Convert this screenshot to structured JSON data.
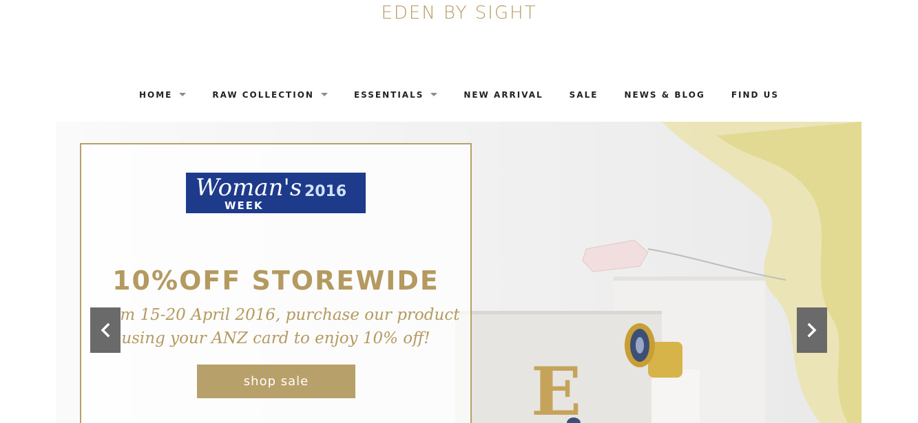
{
  "header": {
    "logo_text": "EDEN BY SIGHT"
  },
  "nav": {
    "items": [
      {
        "label": "HOME",
        "has_dropdown": true
      },
      {
        "label": "RAW COLLECTION",
        "has_dropdown": true
      },
      {
        "label": "ESSENTIALS",
        "has_dropdown": true
      },
      {
        "label": "NEW ARRIVAL",
        "has_dropdown": false
      },
      {
        "label": "SALE",
        "has_dropdown": false
      },
      {
        "label": "NEWS & BLOG",
        "has_dropdown": false
      },
      {
        "label": "FIND US",
        "has_dropdown": false
      }
    ]
  },
  "slider": {
    "badge": {
      "script_text": "Woman's",
      "week_text": "WEEK",
      "year_text": "2016"
    },
    "headline": "10%OFF STOREWIDE",
    "description_line1": "From 15-20 April 2016, purchase our product",
    "description_line2": "using your ANZ card to enjoy 10% off!",
    "cta_label": "shop sale",
    "prev_icon": "chevron-left-icon",
    "next_icon": "chevron-right-icon",
    "watermark_letter": "E"
  },
  "colors": {
    "brand_gold": "#b49a60",
    "button_gold": "#b8a06a",
    "badge_blue": "#1e3a8a",
    "arrow_gray": "#6a6a6a"
  }
}
